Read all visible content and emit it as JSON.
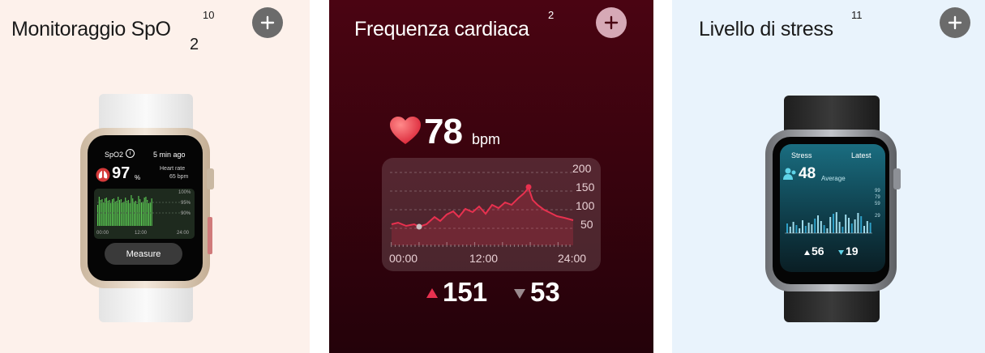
{
  "cards": [
    {
      "title": "Monitoraggio SpO",
      "subscript": "2",
      "footnote": "10",
      "watch": {
        "metric_label": "SpO2",
        "info_glyph": "i",
        "time_ago": "5 min ago",
        "value": "97",
        "unit": "%",
        "hr_label": "Heart rate",
        "hr_value": "65 bpm",
        "y_ticks": [
          "100%",
          "95%",
          "90%"
        ],
        "x_ticks": [
          "00:00",
          "12:00",
          "24:00"
        ],
        "button_label": "Measure"
      }
    },
    {
      "title": "Frequenza cardiaca",
      "footnote": "2",
      "value": "78",
      "unit": "bpm",
      "chart_y_ticks": [
        "200",
        "150",
        "100",
        "50"
      ],
      "chart_x_ticks": [
        "00:00",
        "12:00",
        "24:00"
      ],
      "max_value": "151",
      "min_value": "53"
    },
    {
      "title": "Livello di stress",
      "footnote": "11",
      "watch": {
        "metric_label": "Stress",
        "latest_label": "Latest",
        "value": "48",
        "value_label": "Average",
        "y_ticks": [
          "99",
          "79",
          "59",
          "29"
        ],
        "max_value": "56",
        "min_value": "19"
      }
    }
  ],
  "colors": {
    "add_button_light": "#6b6b6b",
    "add_button_dark": "#d6a9b6",
    "heart_red": "#e8314f",
    "spo2_green": "#5ecf55",
    "stress_blue": "#2ea0c8"
  }
}
